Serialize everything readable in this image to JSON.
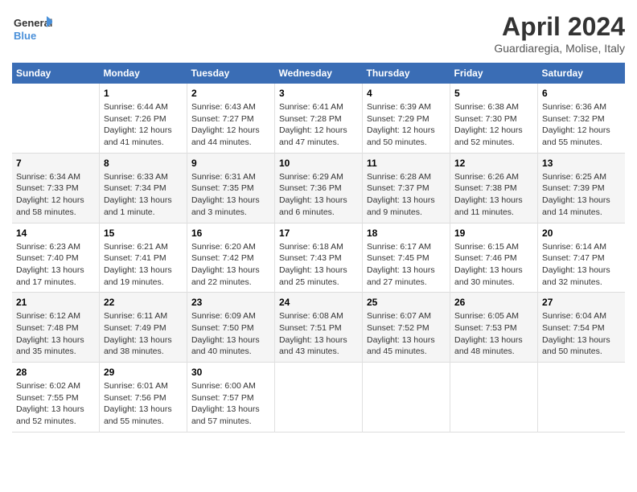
{
  "logo": {
    "line1": "General",
    "line2": "Blue"
  },
  "title": "April 2024",
  "subtitle": "Guardiaregia, Molise, Italy",
  "headers": [
    "Sunday",
    "Monday",
    "Tuesday",
    "Wednesday",
    "Thursday",
    "Friday",
    "Saturday"
  ],
  "weeks": [
    [
      {
        "day": "",
        "info": ""
      },
      {
        "day": "1",
        "info": "Sunrise: 6:44 AM\nSunset: 7:26 PM\nDaylight: 12 hours\nand 41 minutes."
      },
      {
        "day": "2",
        "info": "Sunrise: 6:43 AM\nSunset: 7:27 PM\nDaylight: 12 hours\nand 44 minutes."
      },
      {
        "day": "3",
        "info": "Sunrise: 6:41 AM\nSunset: 7:28 PM\nDaylight: 12 hours\nand 47 minutes."
      },
      {
        "day": "4",
        "info": "Sunrise: 6:39 AM\nSunset: 7:29 PM\nDaylight: 12 hours\nand 50 minutes."
      },
      {
        "day": "5",
        "info": "Sunrise: 6:38 AM\nSunset: 7:30 PM\nDaylight: 12 hours\nand 52 minutes."
      },
      {
        "day": "6",
        "info": "Sunrise: 6:36 AM\nSunset: 7:32 PM\nDaylight: 12 hours\nand 55 minutes."
      }
    ],
    [
      {
        "day": "7",
        "info": "Sunrise: 6:34 AM\nSunset: 7:33 PM\nDaylight: 12 hours\nand 58 minutes."
      },
      {
        "day": "8",
        "info": "Sunrise: 6:33 AM\nSunset: 7:34 PM\nDaylight: 13 hours\nand 1 minute."
      },
      {
        "day": "9",
        "info": "Sunrise: 6:31 AM\nSunset: 7:35 PM\nDaylight: 13 hours\nand 3 minutes."
      },
      {
        "day": "10",
        "info": "Sunrise: 6:29 AM\nSunset: 7:36 PM\nDaylight: 13 hours\nand 6 minutes."
      },
      {
        "day": "11",
        "info": "Sunrise: 6:28 AM\nSunset: 7:37 PM\nDaylight: 13 hours\nand 9 minutes."
      },
      {
        "day": "12",
        "info": "Sunrise: 6:26 AM\nSunset: 7:38 PM\nDaylight: 13 hours\nand 11 minutes."
      },
      {
        "day": "13",
        "info": "Sunrise: 6:25 AM\nSunset: 7:39 PM\nDaylight: 13 hours\nand 14 minutes."
      }
    ],
    [
      {
        "day": "14",
        "info": "Sunrise: 6:23 AM\nSunset: 7:40 PM\nDaylight: 13 hours\nand 17 minutes."
      },
      {
        "day": "15",
        "info": "Sunrise: 6:21 AM\nSunset: 7:41 PM\nDaylight: 13 hours\nand 19 minutes."
      },
      {
        "day": "16",
        "info": "Sunrise: 6:20 AM\nSunset: 7:42 PM\nDaylight: 13 hours\nand 22 minutes."
      },
      {
        "day": "17",
        "info": "Sunrise: 6:18 AM\nSunset: 7:43 PM\nDaylight: 13 hours\nand 25 minutes."
      },
      {
        "day": "18",
        "info": "Sunrise: 6:17 AM\nSunset: 7:45 PM\nDaylight: 13 hours\nand 27 minutes."
      },
      {
        "day": "19",
        "info": "Sunrise: 6:15 AM\nSunset: 7:46 PM\nDaylight: 13 hours\nand 30 minutes."
      },
      {
        "day": "20",
        "info": "Sunrise: 6:14 AM\nSunset: 7:47 PM\nDaylight: 13 hours\nand 32 minutes."
      }
    ],
    [
      {
        "day": "21",
        "info": "Sunrise: 6:12 AM\nSunset: 7:48 PM\nDaylight: 13 hours\nand 35 minutes."
      },
      {
        "day": "22",
        "info": "Sunrise: 6:11 AM\nSunset: 7:49 PM\nDaylight: 13 hours\nand 38 minutes."
      },
      {
        "day": "23",
        "info": "Sunrise: 6:09 AM\nSunset: 7:50 PM\nDaylight: 13 hours\nand 40 minutes."
      },
      {
        "day": "24",
        "info": "Sunrise: 6:08 AM\nSunset: 7:51 PM\nDaylight: 13 hours\nand 43 minutes."
      },
      {
        "day": "25",
        "info": "Sunrise: 6:07 AM\nSunset: 7:52 PM\nDaylight: 13 hours\nand 45 minutes."
      },
      {
        "day": "26",
        "info": "Sunrise: 6:05 AM\nSunset: 7:53 PM\nDaylight: 13 hours\nand 48 minutes."
      },
      {
        "day": "27",
        "info": "Sunrise: 6:04 AM\nSunset: 7:54 PM\nDaylight: 13 hours\nand 50 minutes."
      }
    ],
    [
      {
        "day": "28",
        "info": "Sunrise: 6:02 AM\nSunset: 7:55 PM\nDaylight: 13 hours\nand 52 minutes."
      },
      {
        "day": "29",
        "info": "Sunrise: 6:01 AM\nSunset: 7:56 PM\nDaylight: 13 hours\nand 55 minutes."
      },
      {
        "day": "30",
        "info": "Sunrise: 6:00 AM\nSunset: 7:57 PM\nDaylight: 13 hours\nand 57 minutes."
      },
      {
        "day": "",
        "info": ""
      },
      {
        "day": "",
        "info": ""
      },
      {
        "day": "",
        "info": ""
      },
      {
        "day": "",
        "info": ""
      }
    ]
  ]
}
